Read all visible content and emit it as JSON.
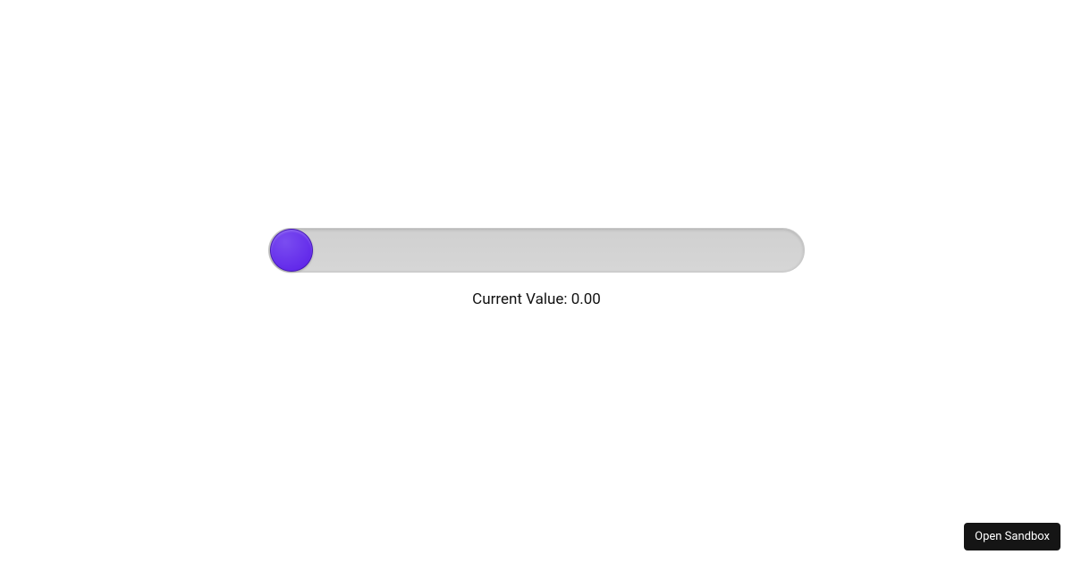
{
  "slider": {
    "value_label_prefix": "Current Value: ",
    "value": "0.00",
    "thumb_color": "#5a1de8",
    "track_color": "#d6d6d6"
  },
  "sandbox": {
    "button_label": "Open Sandbox"
  }
}
